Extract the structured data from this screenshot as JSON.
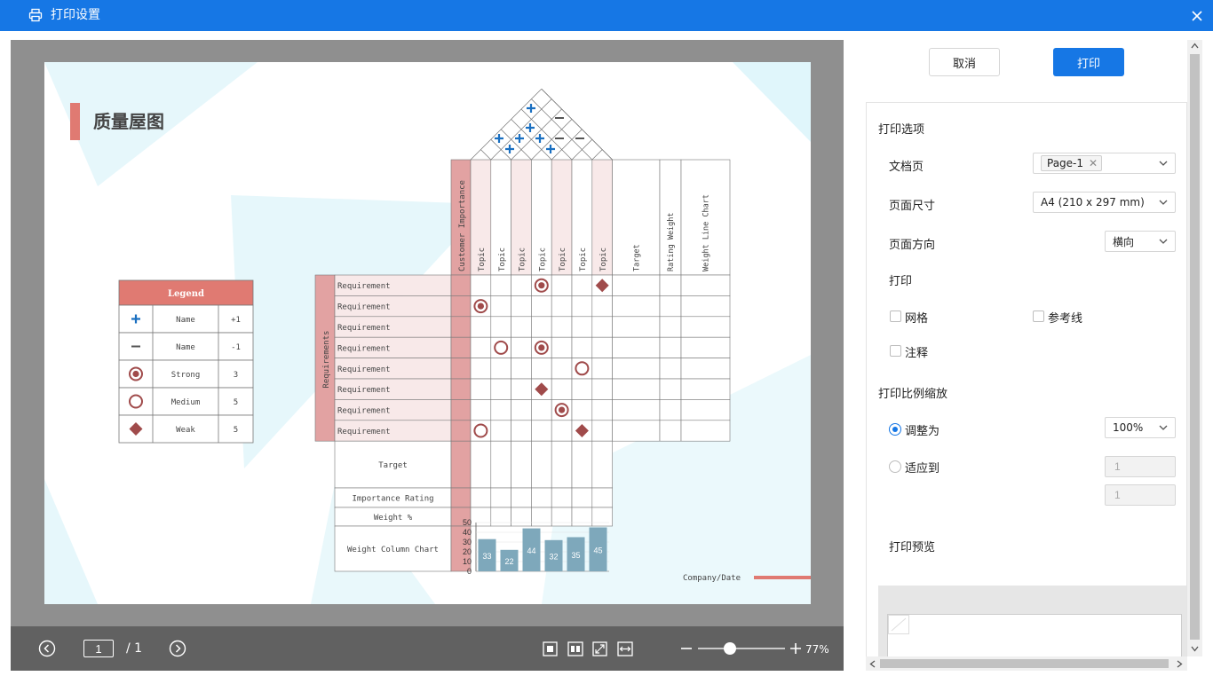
{
  "window": {
    "title": "打印设置"
  },
  "doc": {
    "title": "质量屋图",
    "legend": {
      "header": "Legend",
      "rows": [
        {
          "symbol": "plus",
          "name": "Name",
          "value": "+1"
        },
        {
          "symbol": "minus",
          "name": "Name",
          "value": "-1"
        },
        {
          "symbol": "strong",
          "name": "Strong",
          "value": "3"
        },
        {
          "symbol": "medium",
          "name": "Medium",
          "value": "5"
        },
        {
          "symbol": "weak",
          "name": "Weak",
          "value": "5"
        }
      ]
    },
    "importance_label": "Customer Importance",
    "topics": [
      "Topic",
      "Topic",
      "Topic",
      "Topic",
      "Topic",
      "Topic",
      "Topic"
    ],
    "extra_columns": [
      "Target",
      "Rating Weight",
      "Weight Line Chart"
    ],
    "requirements_label": "Requirements",
    "requirements": [
      "Requirement",
      "Requirement",
      "Requirement",
      "Requirement",
      "Requirement",
      "Requirement",
      "Requirement",
      "Requirement"
    ],
    "relationships": [
      {
        "row": 0,
        "col": 3,
        "type": "strong"
      },
      {
        "row": 0,
        "col": 6,
        "type": "weak"
      },
      {
        "row": 1,
        "col": 0,
        "type": "strong"
      },
      {
        "row": 3,
        "col": 1,
        "type": "medium"
      },
      {
        "row": 3,
        "col": 3,
        "type": "strong"
      },
      {
        "row": 4,
        "col": 5,
        "type": "medium"
      },
      {
        "row": 5,
        "col": 3,
        "type": "weak"
      },
      {
        "row": 6,
        "col": 4,
        "type": "strong"
      },
      {
        "row": 7,
        "col": 0,
        "type": "medium"
      },
      {
        "row": 7,
        "col": 5,
        "type": "weak"
      }
    ],
    "roof": {
      "plus": [
        "+",
        "+",
        "+",
        "+",
        "+",
        "+"
      ],
      "minus": [
        "−",
        "−",
        "−",
        "−"
      ]
    },
    "bottom_rows": [
      "Target",
      "Importance Rating",
      "Weight %",
      "Weight Column Chart"
    ],
    "company": "Company/Date",
    "colors": {
      "accent": "#e07a72",
      "pink_band": "#e2a2a2",
      "pink_light": "#f8e9e9",
      "bar": "#7ea8bb",
      "symbol": "#a04b4b",
      "plus": "#1a6fc0"
    }
  },
  "chart_data": {
    "type": "bar",
    "categories": [
      "Topic",
      "Topic",
      "Topic",
      "Topic",
      "Topic",
      "Topic"
    ],
    "values": [
      33,
      22,
      44,
      32,
      35,
      45
    ],
    "ylim": [
      0,
      50
    ],
    "yticks": [
      "0",
      "10",
      "20",
      "30",
      "40",
      "50"
    ],
    "data_labels": [
      "33",
      "22",
      "44",
      "32",
      "35",
      "45"
    ]
  },
  "viewer": {
    "page_current": "1",
    "page_total": "/ 1",
    "zoom": "77%"
  },
  "panel": {
    "cancel": "取消",
    "print": "打印",
    "options_title": "打印选项",
    "doc_page_label": "文档页",
    "doc_page_value": "Page-1",
    "page_size_label": "页面尺寸",
    "page_size_value": "A4 (210 x 297 mm)",
    "orientation_label": "页面方向",
    "orientation_value": "横向",
    "print_label": "打印",
    "grid_label": "网格",
    "guides_label": "参考线",
    "notes_label": "注释",
    "scale_title": "打印比例缩放",
    "adjust_label": "调整为",
    "adjust_value": "100%",
    "fit_label": "适应到",
    "fit_w": "1",
    "fit_h": "1",
    "preview_label": "打印预览"
  }
}
